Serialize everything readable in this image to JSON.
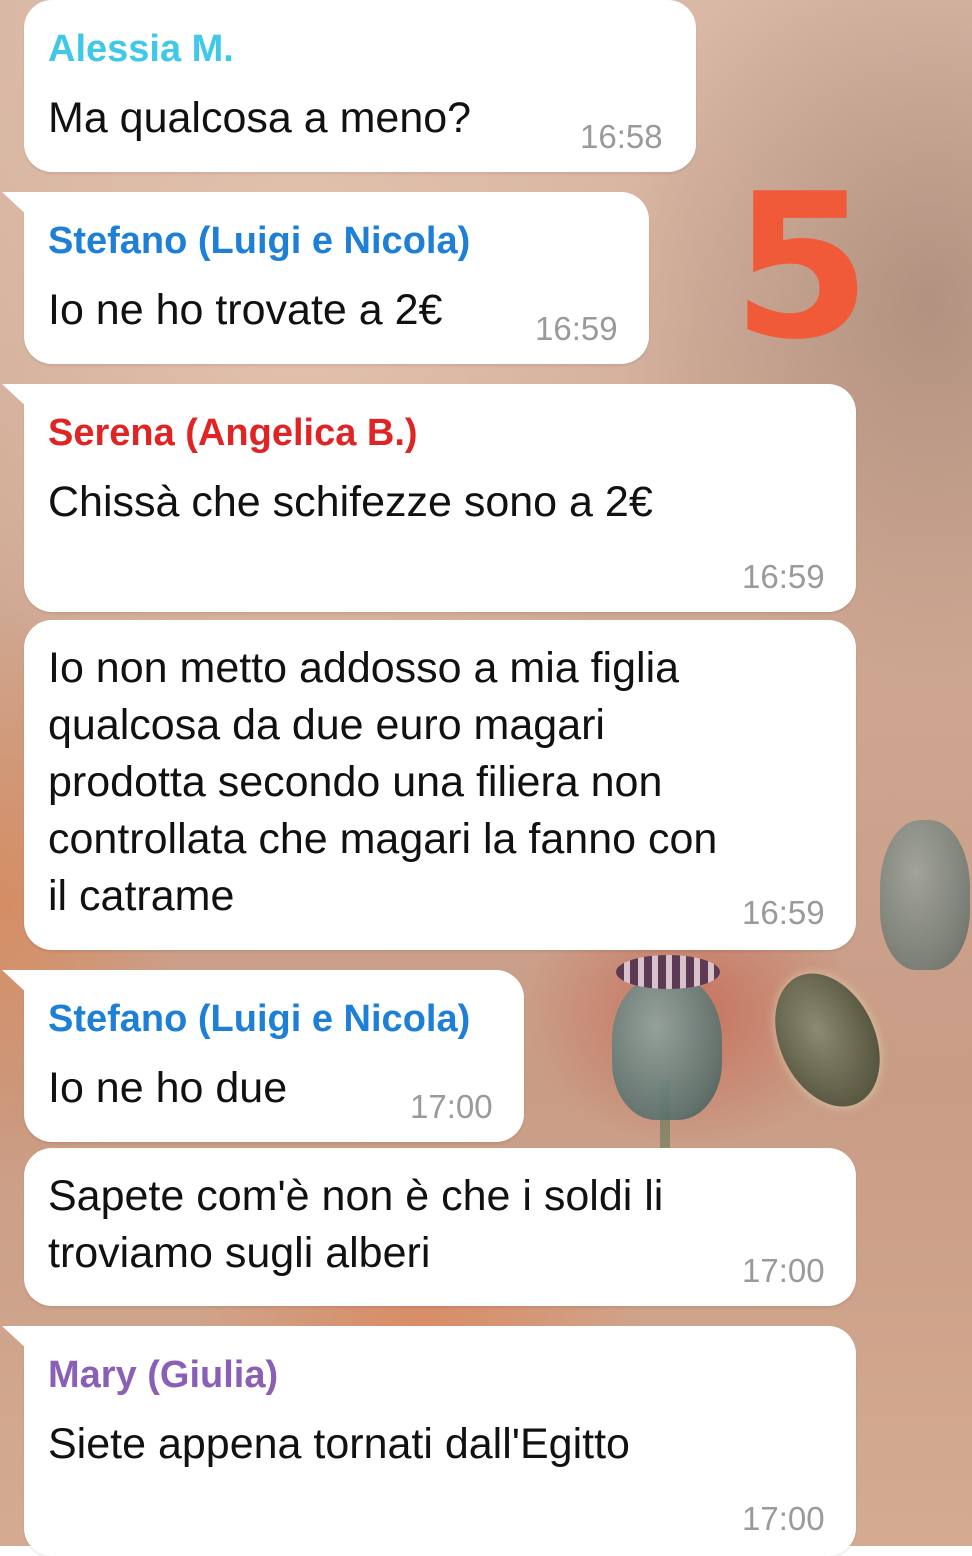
{
  "chat": {
    "messages": [
      {
        "sender": "Alessia M.",
        "sender_color": "#3fc9e6",
        "text": "Ma qualcosa a meno?",
        "time": "16:58"
      },
      {
        "sender": "Stefano (Luigi e Nicola)",
        "sender_color": "#1e7fd6",
        "text": "Io ne ho trovate a 2€",
        "time": "16:59"
      },
      {
        "sender": "Serena (Angelica B.)",
        "sender_color": "#e02424",
        "text": "Chissà che schifezze sono a 2€",
        "time": "16:59"
      },
      {
        "sender": "",
        "text": "Io non metto addosso a mia figlia\nqualcosa da due euro magari\nprodotta secondo una filiera non\ncontrollata che magari la fanno con\nil catrame",
        "time": "16:59"
      },
      {
        "sender": "Stefano (Luigi e Nicola)",
        "sender_color": "#1e7fd6",
        "text": "Io ne ho due",
        "time": "17:00"
      },
      {
        "sender": "",
        "text": "Sapete com'è non è che i soldi li\ntroviamo sugli alberi",
        "time": "17:00"
      },
      {
        "sender": "Mary (Giulia)",
        "sender_color": "#8a5fb5",
        "text": "Siete appena tornati dall'Egitto",
        "time": "17:00"
      }
    ]
  },
  "sticker": {
    "text": "5",
    "color": "#f05a38"
  }
}
